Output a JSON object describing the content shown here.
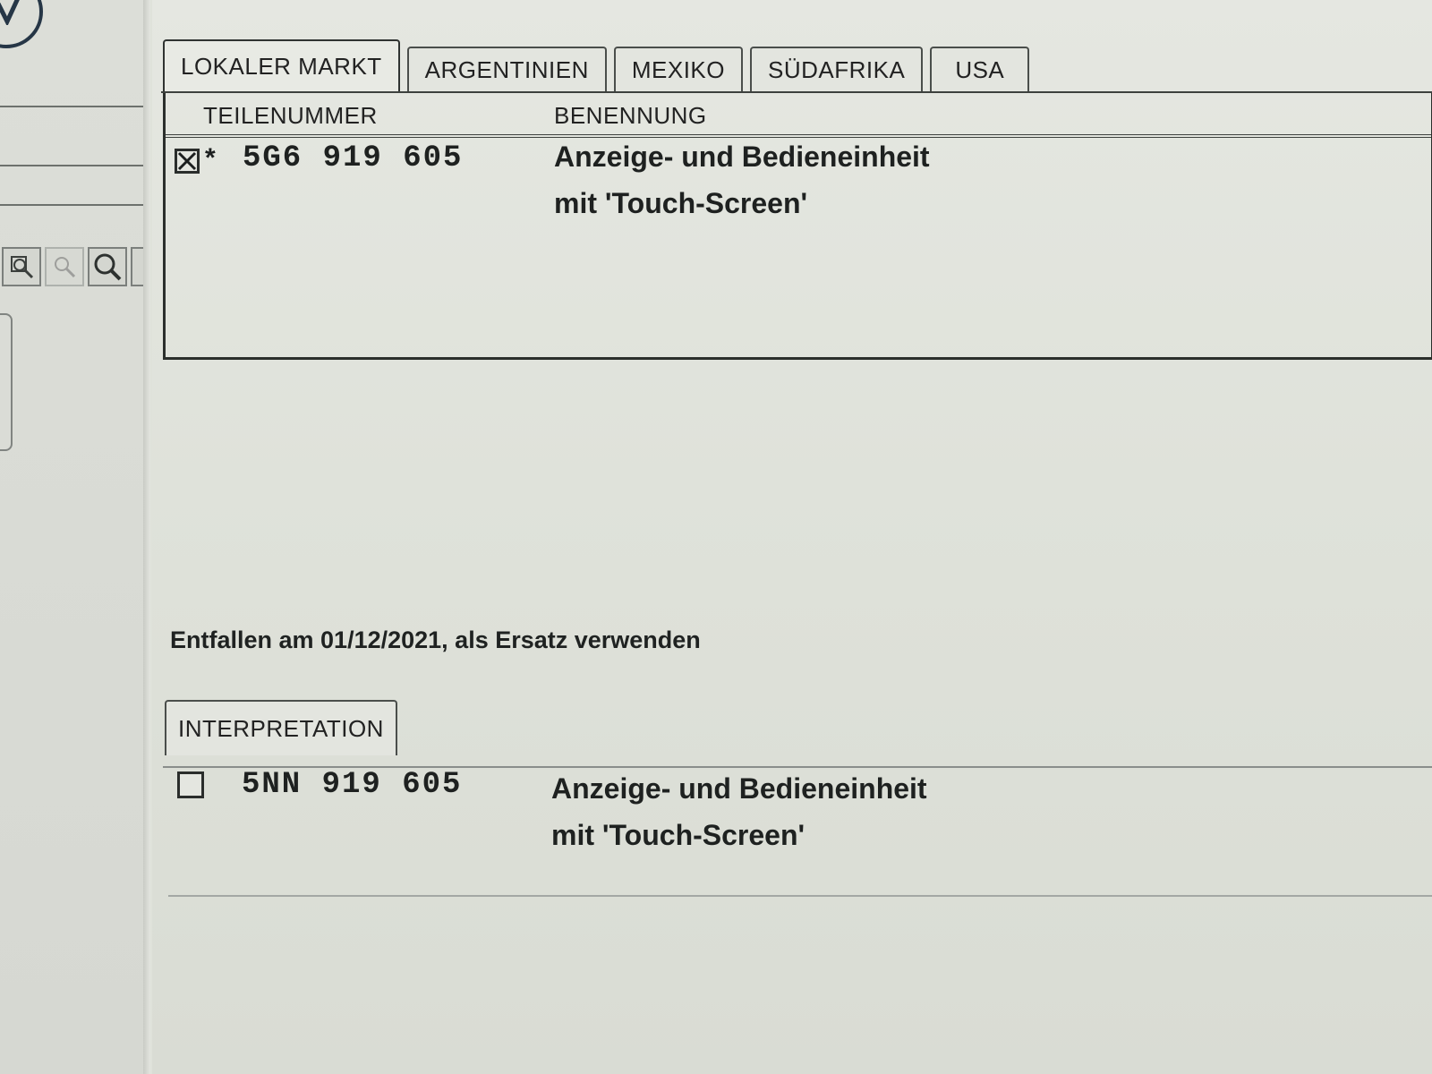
{
  "tabs": [
    "LOKALER MARKT",
    "ARGENTINIEN",
    "MEXIKO",
    "SÜDAFRIKA",
    "USA"
  ],
  "active_tab": "LOKALER MARKT",
  "columns": {
    "part_number": "TEILENUMMER",
    "description": "BENENNUNG"
  },
  "main_part": {
    "checked": true,
    "marker": "*",
    "number": "5G6 919 605",
    "description_line1": "Anzeige- und Bedieneinheit",
    "description_line2": "mit 'Touch-Screen'"
  },
  "status": "Entfallen am 01/12/2021, als Ersatz verwenden",
  "interpretation": {
    "tab": "INTERPRETATION",
    "part": {
      "checked": false,
      "number": "5NN 919 605",
      "description_line1": "Anzeige- und Bedieneinheit",
      "description_line2": "mit 'Touch-Screen'"
    }
  },
  "toolbar_icons": [
    "zoom-in-icon",
    "zoom-out-icon",
    "magnifier-icon"
  ],
  "colors": {
    "background": "#dfe2da",
    "text": "#1c1f1f",
    "border": "#2b2f2c"
  }
}
